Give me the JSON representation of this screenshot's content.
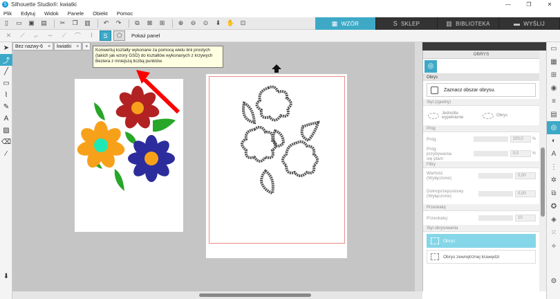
{
  "app": {
    "title": "Silhouette Studio®: kwiatki",
    "window_buttons": [
      "—",
      "❐",
      "✕"
    ]
  },
  "menu": [
    "Plik",
    "Edytuj",
    "Widok",
    "Panele",
    "Obiekt",
    "Pomoc"
  ],
  "tabs": [
    {
      "label": "WZÓR",
      "icon": "design-icon",
      "active": true
    },
    {
      "label": "SKLEP",
      "icon": "store-icon",
      "active": false
    },
    {
      "label": "BIBLIOTEKA",
      "icon": "library-icon",
      "active": false
    },
    {
      "label": "WYŚLIJ",
      "icon": "send-icon",
      "active": false
    }
  ],
  "toolbar2": {
    "show_panel": "Pokaż panel"
  },
  "doc_tabs": [
    {
      "label": "Bez nazwy-6",
      "close": "×"
    },
    {
      "label": "kwiatki",
      "close": "×"
    }
  ],
  "doc_tab_add": "+",
  "tooltip": {
    "line1": "Konwertuj kształty wykonane za pomocą wielu linii prostych",
    "line2": "(takich jak wzory GSD) do kształtów wykonanych z krzywych",
    "line3": "Beziera z mniejszą liczbą punktów."
  },
  "panel": {
    "title": "OBRYS",
    "section_obrys": "Obrys",
    "select_area": "Zaznacz obszar obrysu.",
    "section_fill": "Styl (zgodny)",
    "fill_solid": "Jednolite wypełnienie",
    "fill_outline": "Obrys",
    "section_threshold": "Próg",
    "threshold_label": "Próg",
    "threshold_value": "100,0",
    "threshold_unit": "%",
    "threshold_pass_label": "Próg przybywania się plam",
    "threshold_pass_value": "0,0",
    "threshold_pass_unit": "%",
    "section_filters": "Filtry",
    "highpass_label": "Wartość (Wyłączone)",
    "highpass_value": "0,00",
    "lowpass_label": "Dolnoprzepustowy (Wyłączone)",
    "lowpass_value": "0,00",
    "section_scale": "Przeskaluj",
    "scale_label": "Przeskaluj",
    "scale_value": "10",
    "section_apply": "Styl obrysowania",
    "opt_trace": "Obrys",
    "opt_outer": "Obrys zewnętrznej krawędzi"
  },
  "colors": {
    "accent": "#3ea9c7",
    "red_flower": "#b22222",
    "orange_flower": "#f7a11a",
    "blue_flower": "#2c2c9c",
    "leaf": "#27a627",
    "center": "#f7a11a",
    "cyan_center": "#1de9b6",
    "arrow": "#ff0000"
  }
}
